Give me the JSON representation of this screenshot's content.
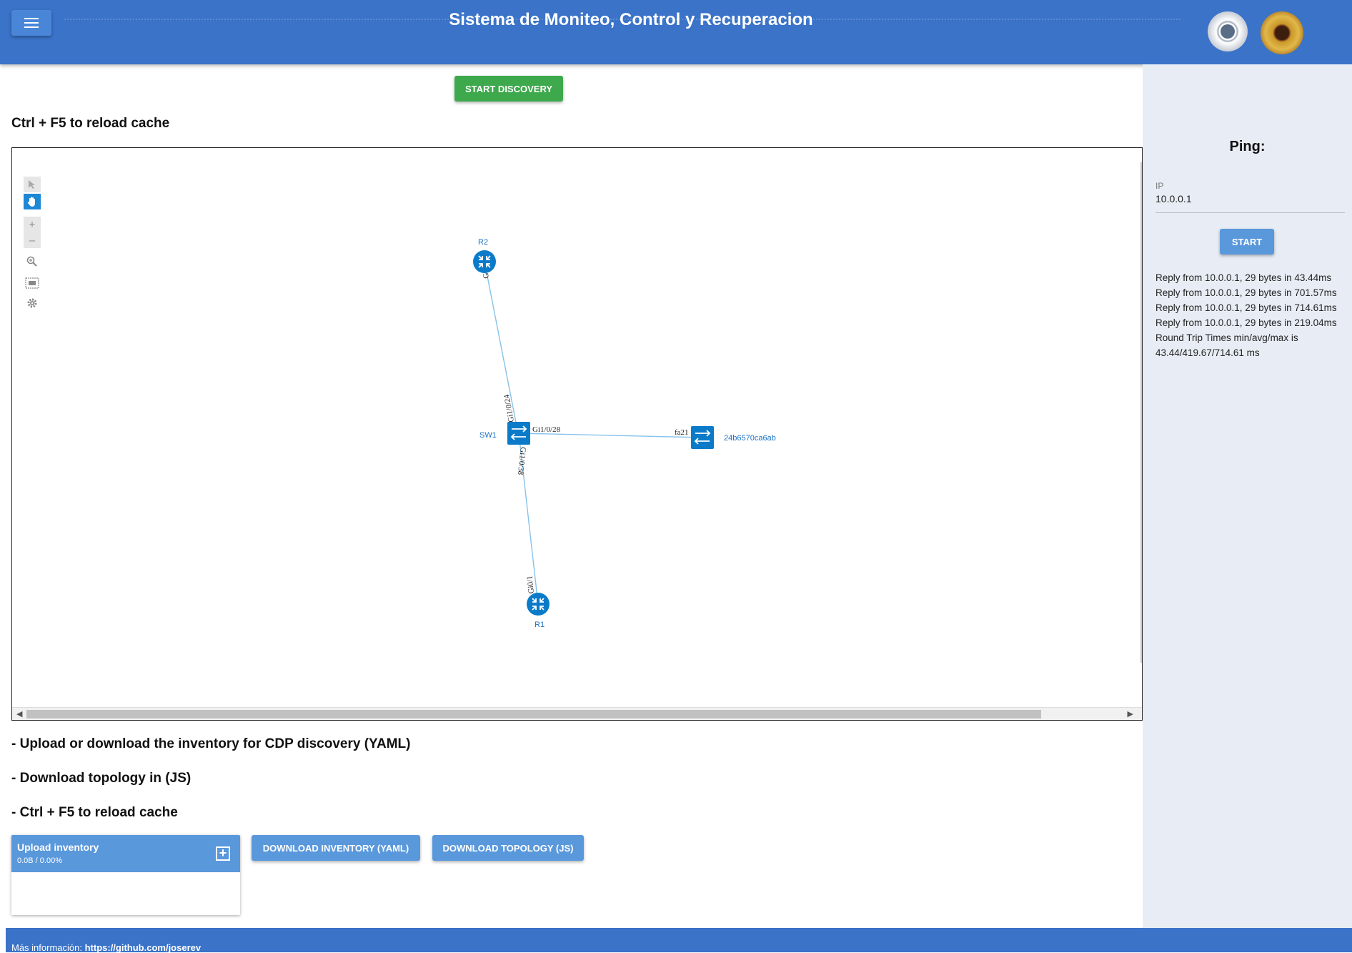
{
  "header": {
    "title": "Sistema de Moniteo, Control y Recuperacion",
    "menu_icon": "menu-icon",
    "logos": [
      "oas-seal",
      "institution-seal"
    ]
  },
  "main": {
    "start_discovery_label": "START DISCOVERY",
    "reload_heading": "Ctrl + F5 to reload cache",
    "topology": {
      "nodes": [
        {
          "id": "R2",
          "label": "R2",
          "type": "router"
        },
        {
          "id": "SW1",
          "label": "SW1",
          "type": "switch"
        },
        {
          "id": "R1",
          "label": "R1",
          "type": "router"
        },
        {
          "id": "24b6570ca6ab",
          "label": "24b6570ca6ab",
          "type": "switch"
        }
      ],
      "links": [
        {
          "source": "R2",
          "target": "SW1",
          "source_port": "Gi0/1",
          "target_port": "Gi1/0/24"
        },
        {
          "source": "SW1",
          "target": "24b6570ca6ab",
          "source_port": "Gi1/0/28",
          "target_port": "fa21"
        },
        {
          "source": "SW1",
          "target": "R1",
          "source_port": "Gi1/0/38",
          "target_port": "Gi0/1"
        }
      ],
      "tools": [
        "select-icon",
        "pan-icon",
        "zoom-in-icon",
        "zoom-out-icon",
        "zoom-selection-icon",
        "fit-view-icon",
        "settings-icon"
      ]
    },
    "sections": [
      "- Upload or download the inventory for CDP discovery (YAML)",
      "- Download topology in (JS)",
      "- Ctrl + F5 to reload cache"
    ],
    "upload": {
      "title": "Upload inventory",
      "status": "0.0B / 0.00%"
    },
    "download_inventory_label": "DOWNLOAD INVENTORY (YAML)",
    "download_topology_label": "DOWNLOAD TOPOLOGY (JS)"
  },
  "sidebar": {
    "title": "Ping:",
    "ip_label": "IP",
    "ip_value": "10.0.0.1",
    "start_label": "START",
    "output": [
      "Reply from 10.0.0.1, 29 bytes in 43.44ms",
      "Reply from 10.0.0.1, 29 bytes in 701.57ms",
      "Reply from 10.0.0.1, 29 bytes in 714.61ms",
      "Reply from 10.0.0.1, 29 bytes in 219.04ms",
      "Round Trip Times min/avg/max is",
      "43.44/419.67/714.61 ms"
    ]
  },
  "footer": {
    "prefix": "Más información: ",
    "link": "https://github.com/joserev"
  },
  "colors": {
    "header": "#3a73c8",
    "primary_button": "#5a98dc",
    "discovery_button": "#3ea84c",
    "node": "#0b7bc9",
    "link": "#86c3ea",
    "sidebar": "#e8edf5"
  }
}
